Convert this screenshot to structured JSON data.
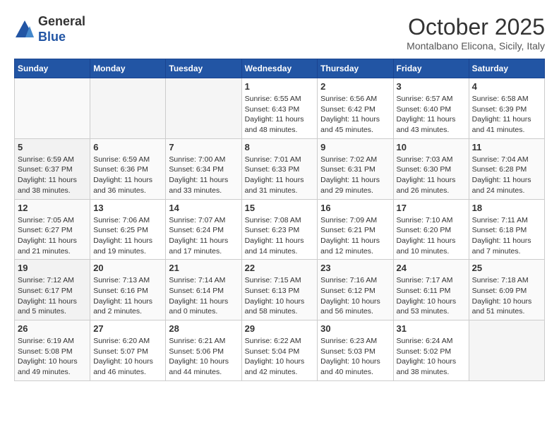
{
  "header": {
    "logo_line1": "General",
    "logo_line2": "Blue",
    "month": "October 2025",
    "location": "Montalbano Elicona, Sicily, Italy"
  },
  "weekdays": [
    "Sunday",
    "Monday",
    "Tuesday",
    "Wednesday",
    "Thursday",
    "Friday",
    "Saturday"
  ],
  "weeks": [
    [
      {
        "day": "",
        "text": ""
      },
      {
        "day": "",
        "text": ""
      },
      {
        "day": "",
        "text": ""
      },
      {
        "day": "1",
        "text": "Sunrise: 6:55 AM\nSunset: 6:43 PM\nDaylight: 11 hours and 48 minutes."
      },
      {
        "day": "2",
        "text": "Sunrise: 6:56 AM\nSunset: 6:42 PM\nDaylight: 11 hours and 45 minutes."
      },
      {
        "day": "3",
        "text": "Sunrise: 6:57 AM\nSunset: 6:40 PM\nDaylight: 11 hours and 43 minutes."
      },
      {
        "day": "4",
        "text": "Sunrise: 6:58 AM\nSunset: 6:39 PM\nDaylight: 11 hours and 41 minutes."
      }
    ],
    [
      {
        "day": "5",
        "text": "Sunrise: 6:59 AM\nSunset: 6:37 PM\nDaylight: 11 hours and 38 minutes."
      },
      {
        "day": "6",
        "text": "Sunrise: 6:59 AM\nSunset: 6:36 PM\nDaylight: 11 hours and 36 minutes."
      },
      {
        "day": "7",
        "text": "Sunrise: 7:00 AM\nSunset: 6:34 PM\nDaylight: 11 hours and 33 minutes."
      },
      {
        "day": "8",
        "text": "Sunrise: 7:01 AM\nSunset: 6:33 PM\nDaylight: 11 hours and 31 minutes."
      },
      {
        "day": "9",
        "text": "Sunrise: 7:02 AM\nSunset: 6:31 PM\nDaylight: 11 hours and 29 minutes."
      },
      {
        "day": "10",
        "text": "Sunrise: 7:03 AM\nSunset: 6:30 PM\nDaylight: 11 hours and 26 minutes."
      },
      {
        "day": "11",
        "text": "Sunrise: 7:04 AM\nSunset: 6:28 PM\nDaylight: 11 hours and 24 minutes."
      }
    ],
    [
      {
        "day": "12",
        "text": "Sunrise: 7:05 AM\nSunset: 6:27 PM\nDaylight: 11 hours and 21 minutes."
      },
      {
        "day": "13",
        "text": "Sunrise: 7:06 AM\nSunset: 6:25 PM\nDaylight: 11 hours and 19 minutes."
      },
      {
        "day": "14",
        "text": "Sunrise: 7:07 AM\nSunset: 6:24 PM\nDaylight: 11 hours and 17 minutes."
      },
      {
        "day": "15",
        "text": "Sunrise: 7:08 AM\nSunset: 6:23 PM\nDaylight: 11 hours and 14 minutes."
      },
      {
        "day": "16",
        "text": "Sunrise: 7:09 AM\nSunset: 6:21 PM\nDaylight: 11 hours and 12 minutes."
      },
      {
        "day": "17",
        "text": "Sunrise: 7:10 AM\nSunset: 6:20 PM\nDaylight: 11 hours and 10 minutes."
      },
      {
        "day": "18",
        "text": "Sunrise: 7:11 AM\nSunset: 6:18 PM\nDaylight: 11 hours and 7 minutes."
      }
    ],
    [
      {
        "day": "19",
        "text": "Sunrise: 7:12 AM\nSunset: 6:17 PM\nDaylight: 11 hours and 5 minutes."
      },
      {
        "day": "20",
        "text": "Sunrise: 7:13 AM\nSunset: 6:16 PM\nDaylight: 11 hours and 2 minutes."
      },
      {
        "day": "21",
        "text": "Sunrise: 7:14 AM\nSunset: 6:14 PM\nDaylight: 11 hours and 0 minutes."
      },
      {
        "day": "22",
        "text": "Sunrise: 7:15 AM\nSunset: 6:13 PM\nDaylight: 10 hours and 58 minutes."
      },
      {
        "day": "23",
        "text": "Sunrise: 7:16 AM\nSunset: 6:12 PM\nDaylight: 10 hours and 56 minutes."
      },
      {
        "day": "24",
        "text": "Sunrise: 7:17 AM\nSunset: 6:11 PM\nDaylight: 10 hours and 53 minutes."
      },
      {
        "day": "25",
        "text": "Sunrise: 7:18 AM\nSunset: 6:09 PM\nDaylight: 10 hours and 51 minutes."
      }
    ],
    [
      {
        "day": "26",
        "text": "Sunrise: 6:19 AM\nSunset: 5:08 PM\nDaylight: 10 hours and 49 minutes."
      },
      {
        "day": "27",
        "text": "Sunrise: 6:20 AM\nSunset: 5:07 PM\nDaylight: 10 hours and 46 minutes."
      },
      {
        "day": "28",
        "text": "Sunrise: 6:21 AM\nSunset: 5:06 PM\nDaylight: 10 hours and 44 minutes."
      },
      {
        "day": "29",
        "text": "Sunrise: 6:22 AM\nSunset: 5:04 PM\nDaylight: 10 hours and 42 minutes."
      },
      {
        "day": "30",
        "text": "Sunrise: 6:23 AM\nSunset: 5:03 PM\nDaylight: 10 hours and 40 minutes."
      },
      {
        "day": "31",
        "text": "Sunrise: 6:24 AM\nSunset: 5:02 PM\nDaylight: 10 hours and 38 minutes."
      },
      {
        "day": "",
        "text": ""
      }
    ]
  ]
}
